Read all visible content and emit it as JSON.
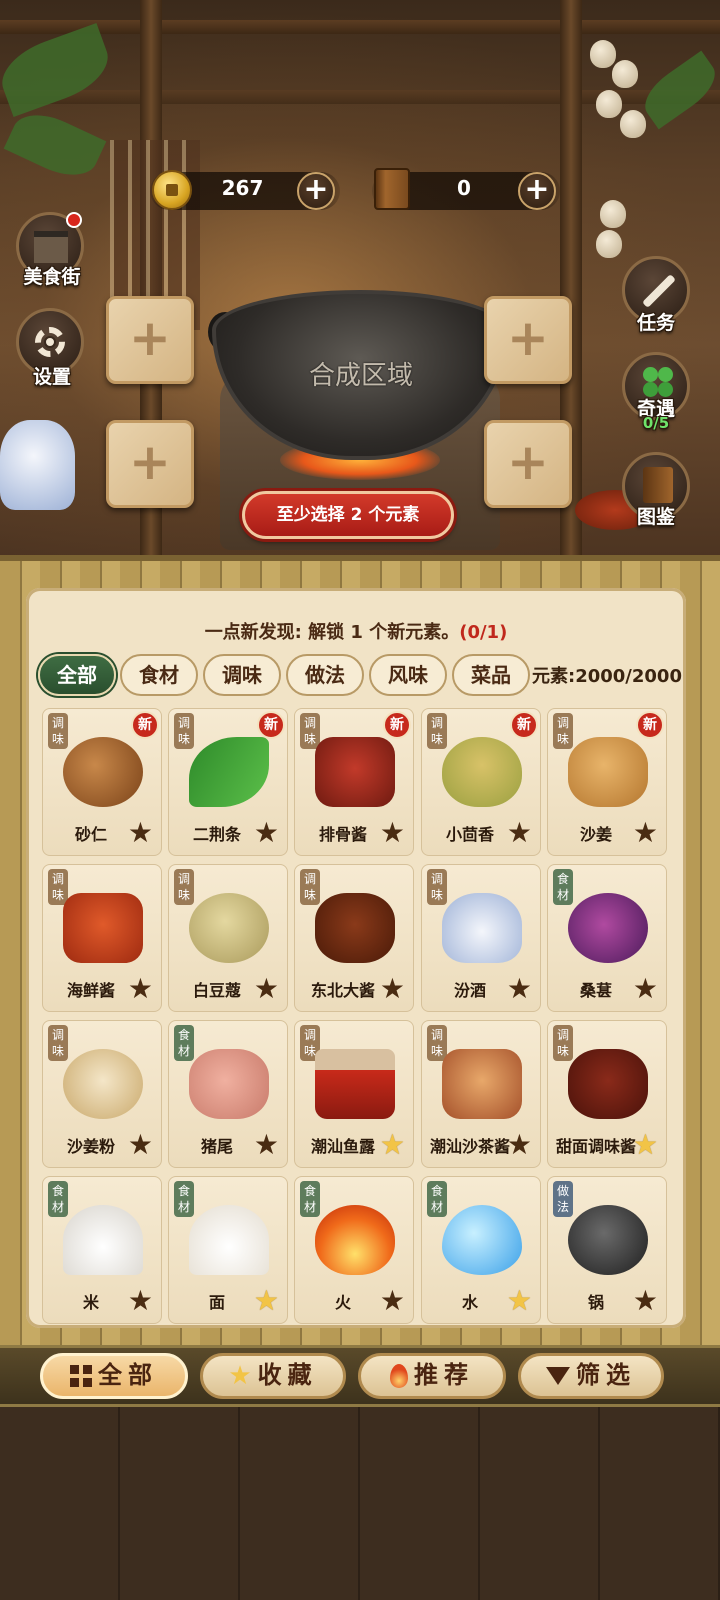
{
  "resources": {
    "coins": "267",
    "books": "0",
    "add_symbol": "+"
  },
  "side_left": [
    {
      "label": "美食街"
    },
    {
      "label": "设置"
    }
  ],
  "side_right": [
    {
      "label": "任务"
    },
    {
      "label": "奇遇",
      "sub": "0/5"
    },
    {
      "label": "图鉴"
    }
  ],
  "synthesis": {
    "area_label": "合成区域",
    "slot_symbol": "+",
    "hint_button": "至少选择 2 个元素"
  },
  "panel": {
    "discovery_text": "一点新发现: 解锁 1 个新元素。",
    "discovery_progress": "(0/1)",
    "tabs": [
      "全部",
      "食材",
      "调味",
      "做法",
      "风味",
      "菜品"
    ],
    "element_count": "元素:2000/2000"
  },
  "cards": [
    {
      "name": "砂仁",
      "badge": "调味",
      "new": "新",
      "star": "★"
    },
    {
      "name": "二荆条",
      "badge": "调味",
      "new": "新",
      "star": "★"
    },
    {
      "name": "排骨酱",
      "badge": "调味",
      "new": "新",
      "star": "★"
    },
    {
      "name": "小茴香",
      "badge": "调味",
      "new": "新",
      "star": "★"
    },
    {
      "name": "沙姜",
      "badge": "调味",
      "new": "新",
      "star": "★"
    },
    {
      "name": "海鲜酱",
      "badge": "调味",
      "star": "★"
    },
    {
      "name": "白豆蔻",
      "badge": "调味",
      "star": "★"
    },
    {
      "name": "东北大酱",
      "badge": "调味",
      "star": "★"
    },
    {
      "name": "汾酒",
      "badge": "调味",
      "star": "★"
    },
    {
      "name": "桑葚",
      "badge": "食材",
      "star": "★"
    },
    {
      "name": "沙姜粉",
      "badge": "调味",
      "star": "★"
    },
    {
      "name": "猪尾",
      "badge": "食材",
      "star": "★"
    },
    {
      "name": "潮汕鱼露",
      "badge": "调味",
      "star": "★"
    },
    {
      "name": "潮汕沙茶酱",
      "badge": "调味",
      "star": "★"
    },
    {
      "name": "甜面调味酱",
      "badge": "调味",
      "star": "★"
    },
    {
      "name": "米",
      "badge": "食材",
      "star": "★"
    },
    {
      "name": "面",
      "badge": "食材",
      "star": "★"
    },
    {
      "name": "火",
      "badge": "食材",
      "star": "★"
    },
    {
      "name": "水",
      "badge": "食材",
      "star": "★"
    },
    {
      "name": "锅",
      "badge": "做法",
      "star": "★"
    }
  ],
  "card_favorited": [
    false,
    false,
    false,
    false,
    false,
    false,
    false,
    false,
    false,
    false,
    false,
    false,
    true,
    false,
    true,
    false,
    true,
    false,
    true,
    false
  ],
  "bottom_bar": [
    {
      "label": "全部"
    },
    {
      "label": "收藏"
    },
    {
      "label": "推荐"
    },
    {
      "label": "筛选"
    }
  ],
  "colors": {
    "accent_red": "#c7291c",
    "tab_active_green": "#2a4f2e",
    "favorite_gold": "#f2c446"
  }
}
